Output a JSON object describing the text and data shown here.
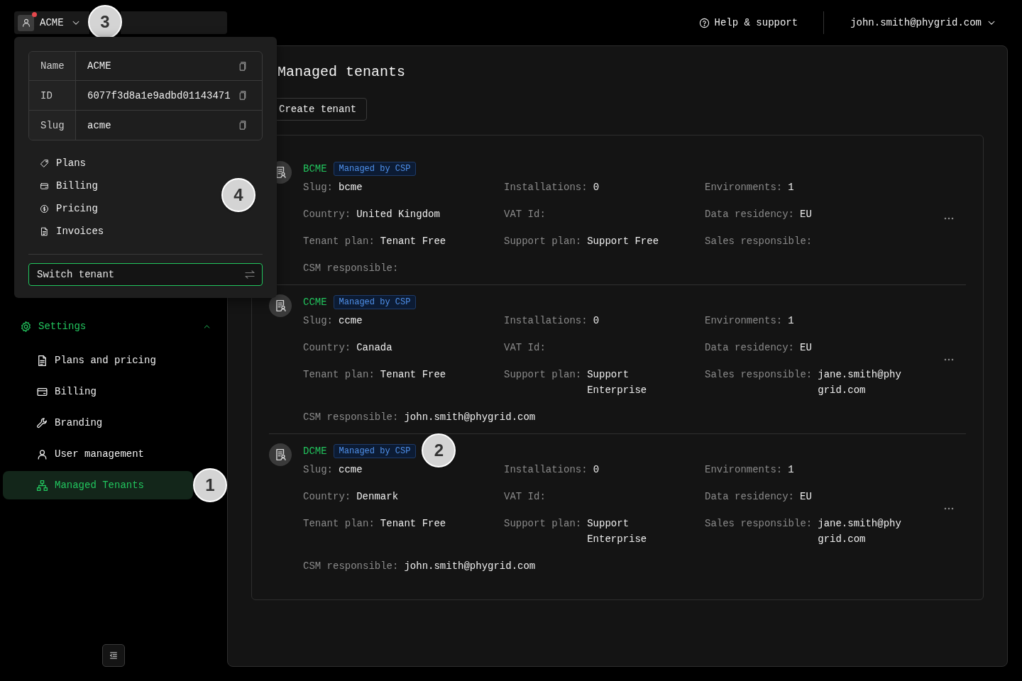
{
  "top_bar": {
    "tenant_switcher": {
      "label": "ACME",
      "notification": true,
      "expanded": true,
      "callout": "3"
    },
    "help_link": "Help & support",
    "user_menu": "john.smith@phygrid.com"
  },
  "tenant_menu": {
    "info_rows": [
      {
        "label": "Name",
        "value": "ACME"
      },
      {
        "label": "ID",
        "value": "6077f3d8a1e9adbd01143471"
      },
      {
        "label": "Slug",
        "value": "acme"
      }
    ],
    "items": [
      "Plans",
      "Billing",
      "Pricing",
      "Invoices"
    ],
    "callout": "4",
    "switch_field": {
      "placeholder": "Switch tenant",
      "focused": true
    }
  },
  "sidebar": {
    "group": {
      "label": "Settings",
      "expanded": true,
      "items": [
        {
          "label": "Plans and pricing",
          "selected": false
        },
        {
          "label": "Billing",
          "selected": false
        },
        {
          "label": "Branding",
          "selected": false
        },
        {
          "label": "User management",
          "selected": false
        },
        {
          "label": "Managed Tenants",
          "selected": true,
          "callout": "1"
        }
      ]
    }
  },
  "main": {
    "title": "Managed tenants",
    "create_button": "Create tenant",
    "tenants": [
      {
        "name": "BCME",
        "badge": "Managed by CSP",
        "fields": [
          {
            "label": "Slug:",
            "value": "bcme"
          },
          {
            "label": "Installations:",
            "value": "0"
          },
          {
            "label": "Environments:",
            "value": "1"
          },
          {
            "label": "Country:",
            "value": "United Kingdom"
          },
          {
            "label": "VAT Id:"
          },
          {
            "label": "Data residency:",
            "value": "EU"
          },
          {
            "label": "Tenant plan:",
            "value": "Tenant Free"
          },
          {
            "label": "Support plan:",
            "value": "Support Free"
          },
          {
            "label": "Sales responsible:"
          },
          {
            "label": "CSM responsible:"
          }
        ]
      },
      {
        "name": "CCME",
        "badge": "Managed by CSP",
        "fields": [
          {
            "label": "Slug:",
            "value": "ccme"
          },
          {
            "label": "Installations:",
            "value": "0"
          },
          {
            "label": "Environments:",
            "value": "1"
          },
          {
            "label": "Country:",
            "value": "Canada"
          },
          {
            "label": "VAT Id:"
          },
          {
            "label": "Data residency:",
            "value": "EU"
          },
          {
            "label": "Tenant plan:",
            "value": "Tenant Free"
          },
          {
            "label": "Support plan:",
            "value": "Support Enterprise"
          },
          {
            "label": "Sales responsible:",
            "value": "jane.smith@phygrid.com"
          },
          {
            "label": "CSM responsible:",
            "value": "john.smith@phygrid.com"
          }
        ]
      },
      {
        "name": "DCME",
        "badge": "Managed by CSP",
        "callout": "2",
        "fields": [
          {
            "label": "Slug:",
            "value": "ccme"
          },
          {
            "label": "Installations:",
            "value": "0"
          },
          {
            "label": "Environments:",
            "value": "1"
          },
          {
            "label": "Country:",
            "value": "Denmark"
          },
          {
            "label": "VAT Id:"
          },
          {
            "label": "Data residency:",
            "value": "EU"
          },
          {
            "label": "Tenant plan:",
            "value": "Tenant Free"
          },
          {
            "label": "Support plan:",
            "value": "Support Enterprise"
          },
          {
            "label": "Sales responsible:",
            "value": "jane.smith@phygrid.com"
          },
          {
            "label": "CSM responsible:",
            "value": "john.smith@phygrid.com"
          }
        ]
      }
    ]
  }
}
